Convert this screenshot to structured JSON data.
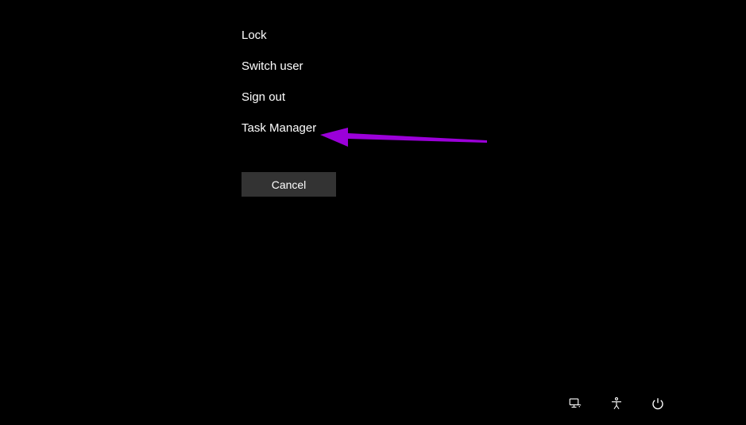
{
  "menu": {
    "items": [
      {
        "label": "Lock"
      },
      {
        "label": "Switch user"
      },
      {
        "label": "Sign out"
      },
      {
        "label": "Task Manager"
      }
    ],
    "cancel_label": "Cancel"
  },
  "icons": {
    "network": "network-icon",
    "accessibility": "accessibility-icon",
    "power": "power-icon"
  },
  "annotation": {
    "arrow_color": "#9b00d9",
    "target_item_index": 3
  }
}
